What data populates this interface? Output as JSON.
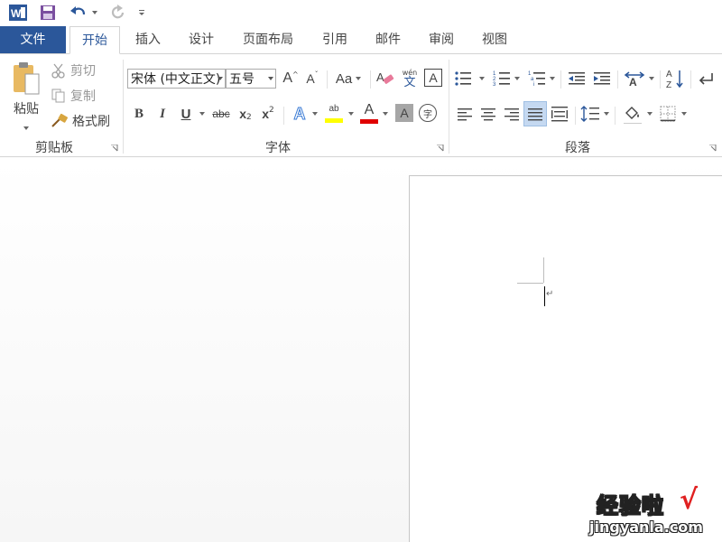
{
  "qat": {
    "app_icon": "word-icon",
    "save_icon": "save-icon",
    "undo_icon": "undo-icon",
    "redo_icon": "redo-icon",
    "customize_icon": "customize-qat-icon"
  },
  "tabs": [
    {
      "label": "文件"
    },
    {
      "label": "开始"
    },
    {
      "label": "插入"
    },
    {
      "label": "设计"
    },
    {
      "label": "页面布局"
    },
    {
      "label": "引用"
    },
    {
      "label": "邮件"
    },
    {
      "label": "审阅"
    },
    {
      "label": "视图"
    }
  ],
  "clipboard": {
    "group_label": "剪贴板",
    "paste_label": "粘贴",
    "cut_label": "剪切",
    "copy_label": "复制",
    "format_painter_label": "格式刷"
  },
  "font": {
    "group_label": "字体",
    "font_name": "宋体 (中文正文)",
    "font_size": "五号",
    "case_label": "Aa",
    "bold_label": "B",
    "italic_label": "I",
    "underline_label": "U",
    "strike_label": "abc",
    "subscript_label": "x",
    "subscript_sub": "2",
    "superscript_label": "x",
    "superscript_sup": "2",
    "text_effects_label": "A",
    "highlight_label": "ab",
    "font_color_label": "A",
    "char_shading_label": "A",
    "enclose_label": "字",
    "phonetic_top": "wén",
    "phonetic_bottom": "文",
    "border_label": "A",
    "grow_label": "A",
    "shrink_label": "A"
  },
  "paragraph": {
    "group_label": "段落",
    "sort_label": "A Z"
  },
  "watermark": {
    "title": "经验啦",
    "check": "√",
    "url": "jingyanla.com"
  },
  "colors": {
    "file_tab": "#2b579a",
    "highlight": "#ffff00",
    "font_color": "#e00000",
    "active_align": "#c5d9f1"
  }
}
